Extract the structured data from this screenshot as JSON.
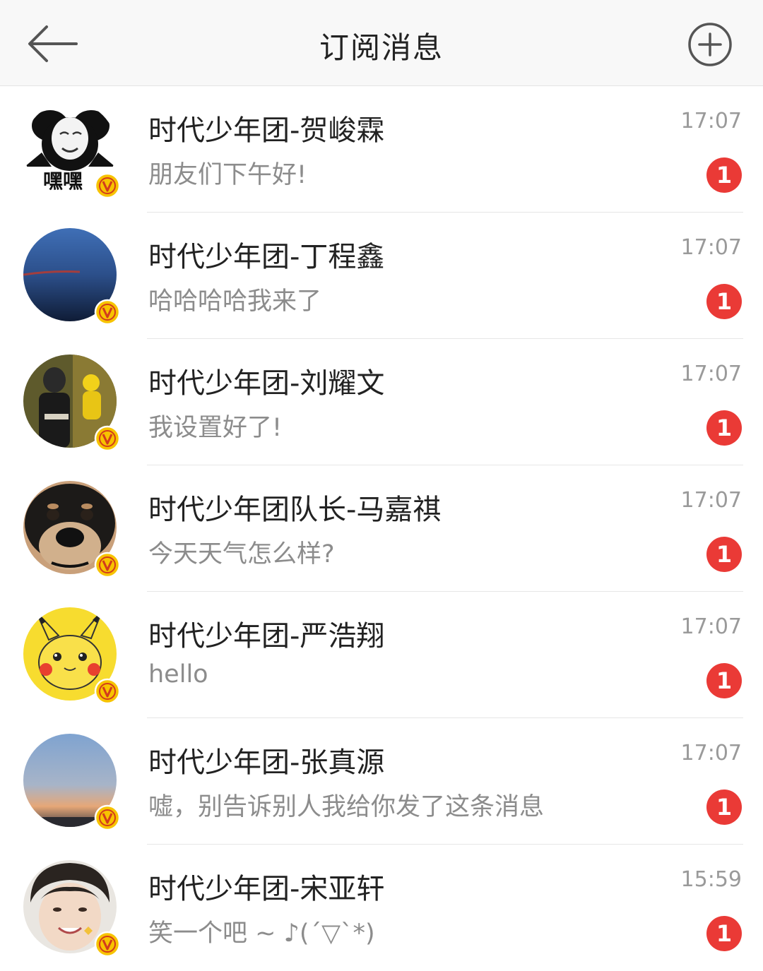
{
  "header": {
    "title": "订阅消息",
    "back_icon": "back-arrow-icon",
    "add_icon": "plus-circle-icon"
  },
  "colors": {
    "badge": "#ea3a36",
    "verified": "#f7c300",
    "header_bg": "#f8f8f8"
  },
  "conversations": [
    {
      "name": "时代少年团-贺峻霖",
      "message": "朋友们下午好!",
      "time": "17:07",
      "unread": "1",
      "avatar_text": "嘿嘿"
    },
    {
      "name": "时代少年团-丁程鑫",
      "message": "哈哈哈哈我来了",
      "time": "17:07",
      "unread": "1"
    },
    {
      "name": "时代少年团-刘耀文",
      "message": "我设置好了!",
      "time": "17:07",
      "unread": "1"
    },
    {
      "name": "时代少年团队长-马嘉祺",
      "message": "今天天气怎么样?",
      "time": "17:07",
      "unread": "1"
    },
    {
      "name": "时代少年团-严浩翔",
      "message": "hello",
      "time": "17:07",
      "unread": "1"
    },
    {
      "name": "时代少年团-张真源",
      "message": "嘘，别告诉别人我给你发了这条消息",
      "time": "17:07",
      "unread": "1"
    },
    {
      "name": "时代少年团-宋亚轩",
      "message": "笑一个吧 ~ ♪(´▽`*)",
      "time": "15:59",
      "unread": "1"
    }
  ]
}
